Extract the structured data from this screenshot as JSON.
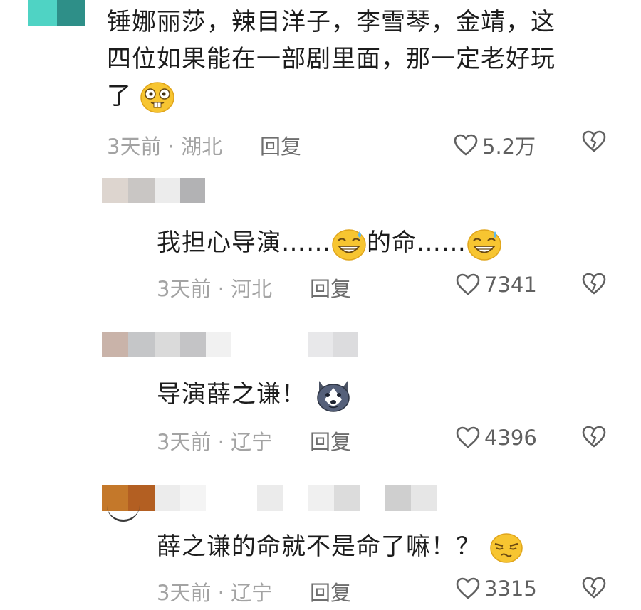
{
  "comments": [
    {
      "text_lines": [
        "锤娜丽莎，辣目洋子，李雪琴，金靖，这",
        "四位如果能在一部剧里面，那一定老好玩",
        "了"
      ],
      "emoji": "buck-teeth-emoji",
      "time": "3天前",
      "location": "湖北",
      "reply_label": "回复",
      "likes": "5.2万",
      "like_icon": "heart-outline-icon",
      "dislike_icon": "broken-heart-icon"
    },
    {
      "text_a": "我担心导演……",
      "text_b": "的命……",
      "emoji": "sweat-grin-emoji",
      "time": "3天前",
      "location": "河北",
      "reply_label": "回复",
      "likes": "7341",
      "like_icon": "heart-outline-icon",
      "dislike_icon": "broken-heart-icon"
    },
    {
      "text": "导演薛之谦！",
      "emoji": "husky-dog-emoji",
      "time": "3天前",
      "location": "辽宁",
      "reply_label": "回复",
      "likes": "4396",
      "like_icon": "heart-outline-icon",
      "dislike_icon": "broken-heart-icon"
    },
    {
      "text": "薛之谦的命就不是命了嘛！？",
      "emoji": "squint-face-emoji",
      "time": "3天前",
      "location": "辽宁",
      "reply_label": "回复",
      "likes": "3315",
      "like_icon": "heart-outline-icon",
      "dislike_icon": "broken-heart-icon"
    }
  ],
  "meta_separator": "·",
  "colors": {
    "meta_gray": "#a3a3a3",
    "reply_gray": "#6e6e6e",
    "emoji_yellow": "#f7c531",
    "mosaic_teal": "#2e9f96"
  }
}
